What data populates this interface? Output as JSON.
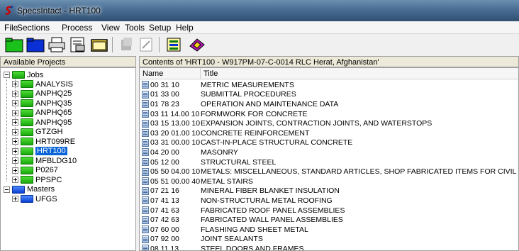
{
  "window": {
    "title": "SpecsIntact - HRT100"
  },
  "menu": [
    "File",
    "Sections",
    "Process",
    "View",
    "Tools",
    "Setup",
    "Help"
  ],
  "toolbar": [
    {
      "icon": "open-folder-green-icon"
    },
    {
      "icon": "open-folder-blue-icon"
    },
    {
      "icon": "print-icon"
    },
    {
      "icon": "properties-icon"
    },
    {
      "icon": "folder-yellow-icon"
    },
    {
      "icon": "disabled-icon"
    },
    {
      "icon": "edit-disabled-icon"
    },
    {
      "icon": "report-icon"
    },
    {
      "icon": "book-icon"
    }
  ],
  "left_panel": {
    "header": "Available Projects",
    "jobs_label": "Jobs",
    "jobs": [
      "ANALYSIS",
      "ANPHQ25",
      "ANPHQ35",
      "ANPHQ65",
      "ANPHQ95",
      "GTZGH",
      "HRT099RE",
      "HRT100",
      "MFBLDG10",
      "P0267",
      "PPSPC"
    ],
    "selected_job": "HRT100",
    "masters_label": "Masters",
    "masters": [
      "UFGS"
    ]
  },
  "right_panel": {
    "header": "Contents of 'HRT100 - W917PM-07-C-0014 RLC Herat, Afghanistan'",
    "columns": [
      "Name",
      "Title"
    ],
    "rows": [
      {
        "name": "00 31 10",
        "title": "METRIC MEASUREMENTS"
      },
      {
        "name": "01 33 00",
        "title": "SUBMITTAL PROCEDURES"
      },
      {
        "name": "01 78 23",
        "title": "OPERATION AND MAINTENANCE DATA"
      },
      {
        "name": "03 11 14.00 10",
        "title": "FORMWORK FOR CONCRETE"
      },
      {
        "name": "03 15 13.00 10",
        "title": "EXPANSION JOINTS, CONTRACTION JOINTS, AND WATERSTOPS"
      },
      {
        "name": "03 20 01.00 10",
        "title": "CONCRETE REINFORCEMENT"
      },
      {
        "name": "03 31 00.00 10",
        "title": "CAST-IN-PLACE STRUCTURAL CONCRETE"
      },
      {
        "name": "04 20 00",
        "title": "MASONRY"
      },
      {
        "name": "05 12 00",
        "title": "STRUCTURAL STEEL"
      },
      {
        "name": "05 50 04.00 10",
        "title": "METALS:  MISCELLANEOUS, STANDARD ARTICLES, SHOP FABRICATED ITEMS FOR CIVIL WORKS STRUCTURES"
      },
      {
        "name": "05 51 00.00 40",
        "title": "METAL STAIRS"
      },
      {
        "name": "07 21 16",
        "title": "MINERAL FIBER BLANKET INSULATION"
      },
      {
        "name": "07 41 13",
        "title": "NON-STRUCTURAL METAL ROOFING"
      },
      {
        "name": "07 41 63",
        "title": "FABRICATED ROOF PANEL ASSEMBLIES"
      },
      {
        "name": "07 42 63",
        "title": "FABRICATED WALL PANEL ASSEMBLIES"
      },
      {
        "name": "07 60 00",
        "title": "FLASHING AND SHEET METAL"
      },
      {
        "name": "07 92 00",
        "title": "JOINT SEALANTS"
      },
      {
        "name": "08 11 13",
        "title": "STEEL DOORS AND FRAMES"
      }
    ]
  }
}
